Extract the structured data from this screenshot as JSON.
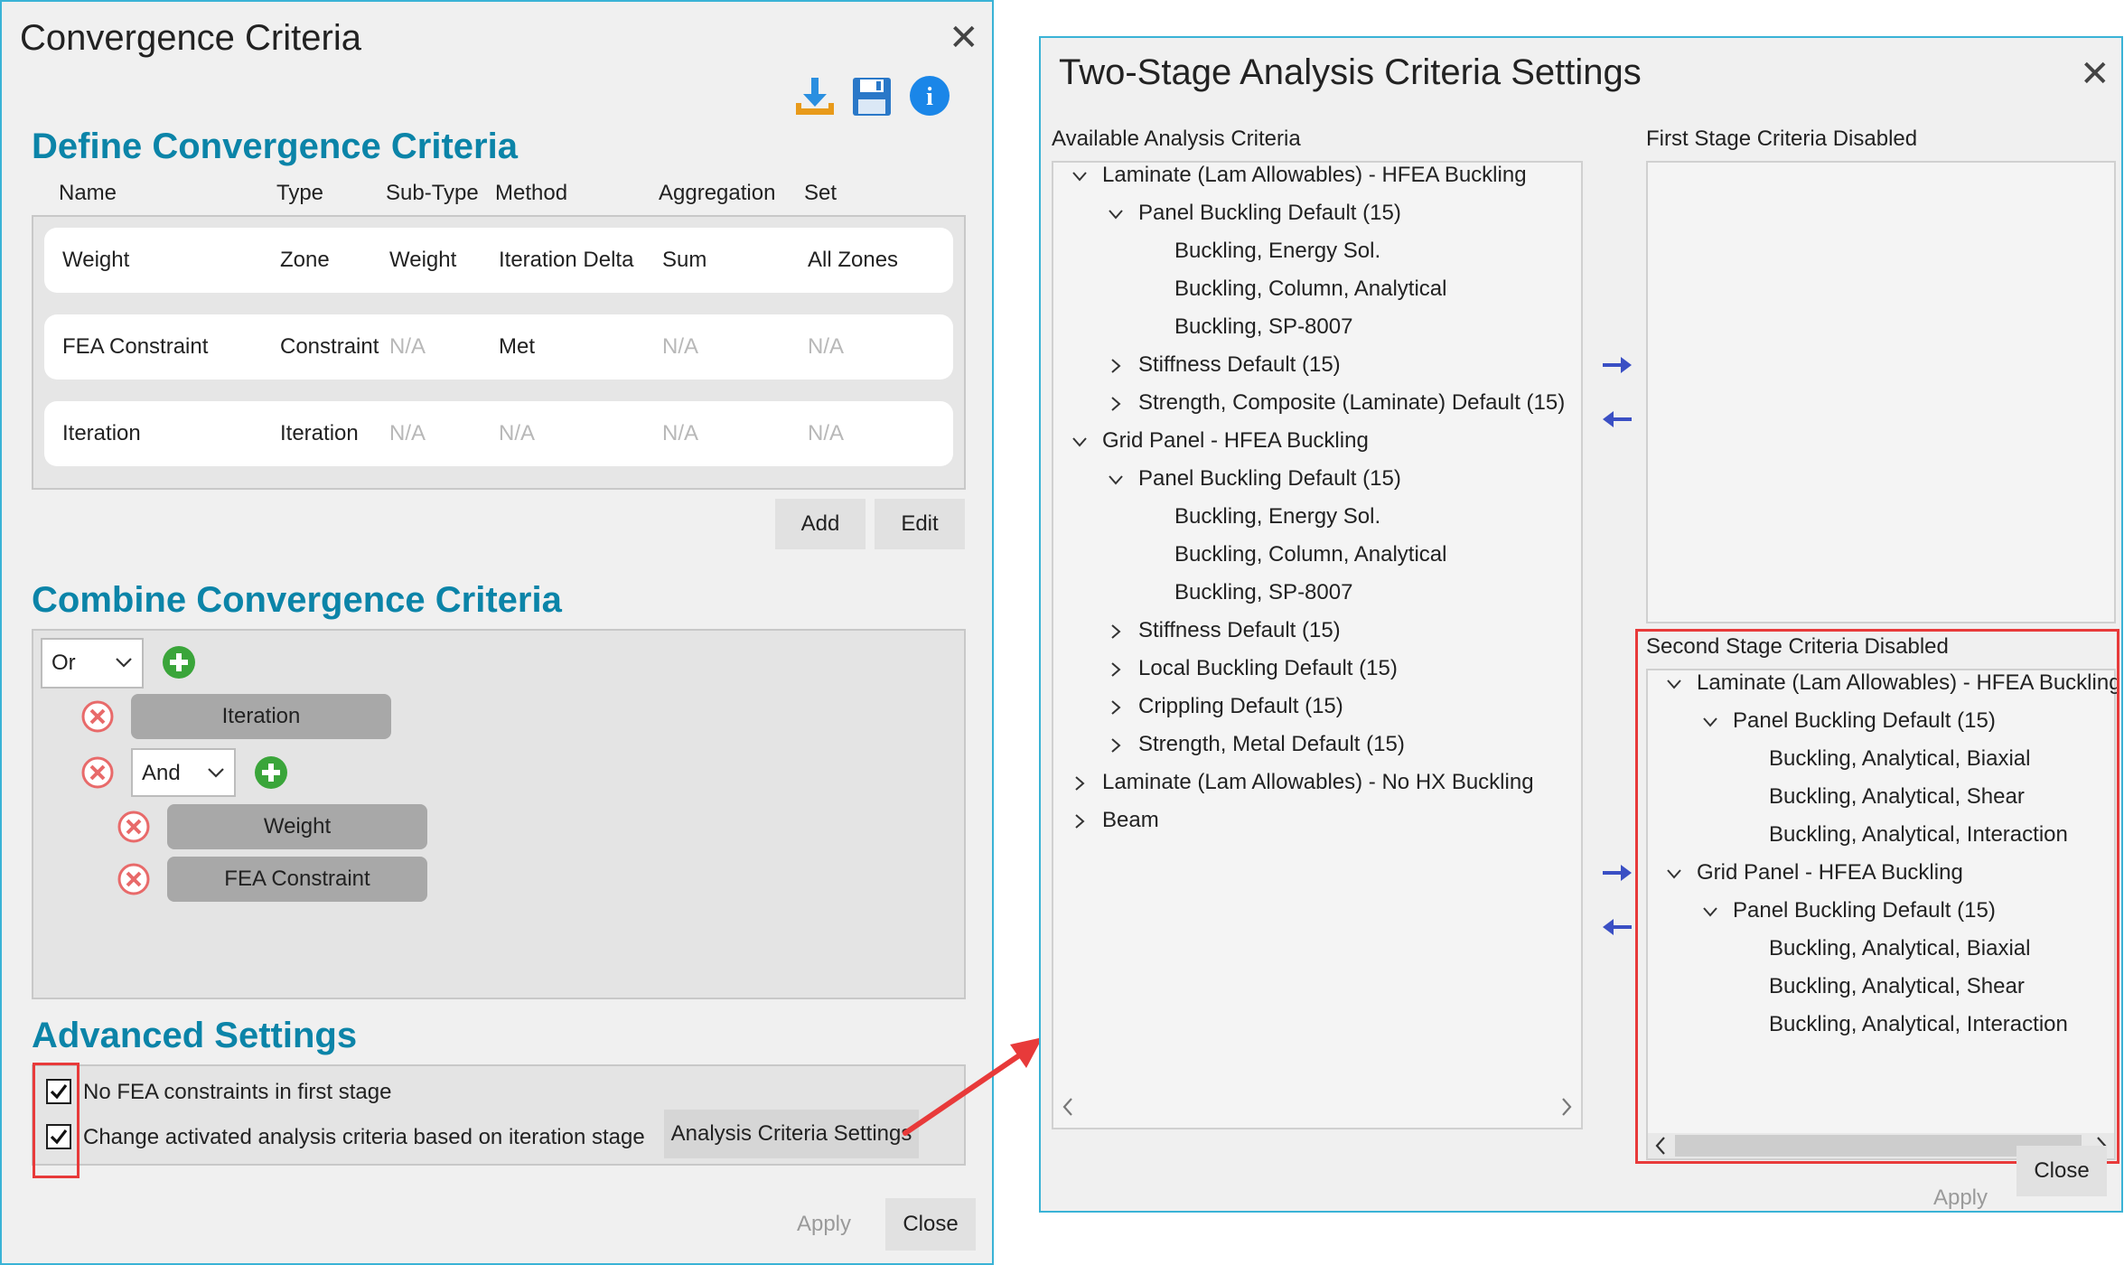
{
  "left_dialog": {
    "title": "Convergence Criteria",
    "close_glyph": "✕",
    "toolbar_icons": [
      "download-icon",
      "save-icon",
      "info-icon"
    ],
    "info_glyph": "i",
    "define": {
      "heading": "Define Convergence Criteria",
      "columns": [
        "Name",
        "Type",
        "Sub-Type",
        "Method",
        "Aggregation",
        "Set"
      ],
      "rows": [
        [
          "Weight",
          "Zone",
          "Weight",
          "Iteration Delta",
          "Sum",
          "All Zones"
        ],
        [
          "FEA Constraint",
          "Constraint",
          "N/A",
          "Met",
          "N/A",
          "N/A"
        ],
        [
          "Iteration",
          "Iteration",
          "N/A",
          "N/A",
          "N/A",
          "N/A"
        ]
      ],
      "add_label": "Add",
      "edit_label": "Edit"
    },
    "combine": {
      "heading": "Combine Convergence Criteria",
      "or_value": "Or",
      "and_value": "And",
      "iteration_label": "Iteration",
      "weight_label": "Weight",
      "fea_label": "FEA Constraint"
    },
    "advanced": {
      "heading": "Advanced Settings",
      "no_fea_label": "No FEA constraints in first stage",
      "change_label": "Change activated analysis criteria based on iteration stage",
      "settings_button": "Analysis Criteria Settings"
    },
    "apply_label": "Apply",
    "close_label": "Close"
  },
  "right_dialog": {
    "title": "Two-Stage Analysis Criteria Settings",
    "close_glyph": "✕",
    "available_label": "Available Analysis Criteria",
    "first_stage_label": "First Stage Criteria Disabled",
    "second_stage_label": "Second Stage Criteria Disabled",
    "tree": [
      "Laminate (Lam Allowables) - HFEA Buckling",
      "Panel Buckling Default (15)",
      "Buckling, Energy Sol.",
      "Buckling, Column, Analytical",
      "Buckling, SP-8007",
      "Stiffness Default (15)",
      "Strength, Composite (Laminate) Default (15)",
      "Grid Panel - HFEA Buckling",
      "Panel Buckling Default (15)",
      "Buckling, Energy Sol.",
      "Buckling, Column, Analytical",
      "Buckling, SP-8007",
      "Stiffness Default (15)",
      "Local Buckling Default (15)",
      "Crippling Default (15)",
      "Strength, Metal Default (15)",
      "Laminate (Lam Allowables) - No HX Buckling",
      "Beam"
    ],
    "second_tree": [
      "Laminate (Lam Allowables) - HFEA Buckling",
      "Panel Buckling Default (15)",
      "Buckling, Analytical, Biaxial",
      "Buckling, Analytical, Shear",
      "Buckling, Analytical, Interaction",
      "Grid Panel - HFEA Buckling",
      "Panel Buckling Default (15)",
      "Buckling, Analytical, Biaxial",
      "Buckling, Analytical, Shear",
      "Buckling, Analytical, Interaction"
    ],
    "apply_label": "Apply",
    "close_label": "Close"
  },
  "colors": {
    "accent": "#0b84a8",
    "window_border": "#3ab3d6",
    "highlight_red": "#e83a3a",
    "arrow_blue": "#3a4fc4",
    "add_green": "#3aa53a",
    "remove_red": "#e86a6a"
  }
}
